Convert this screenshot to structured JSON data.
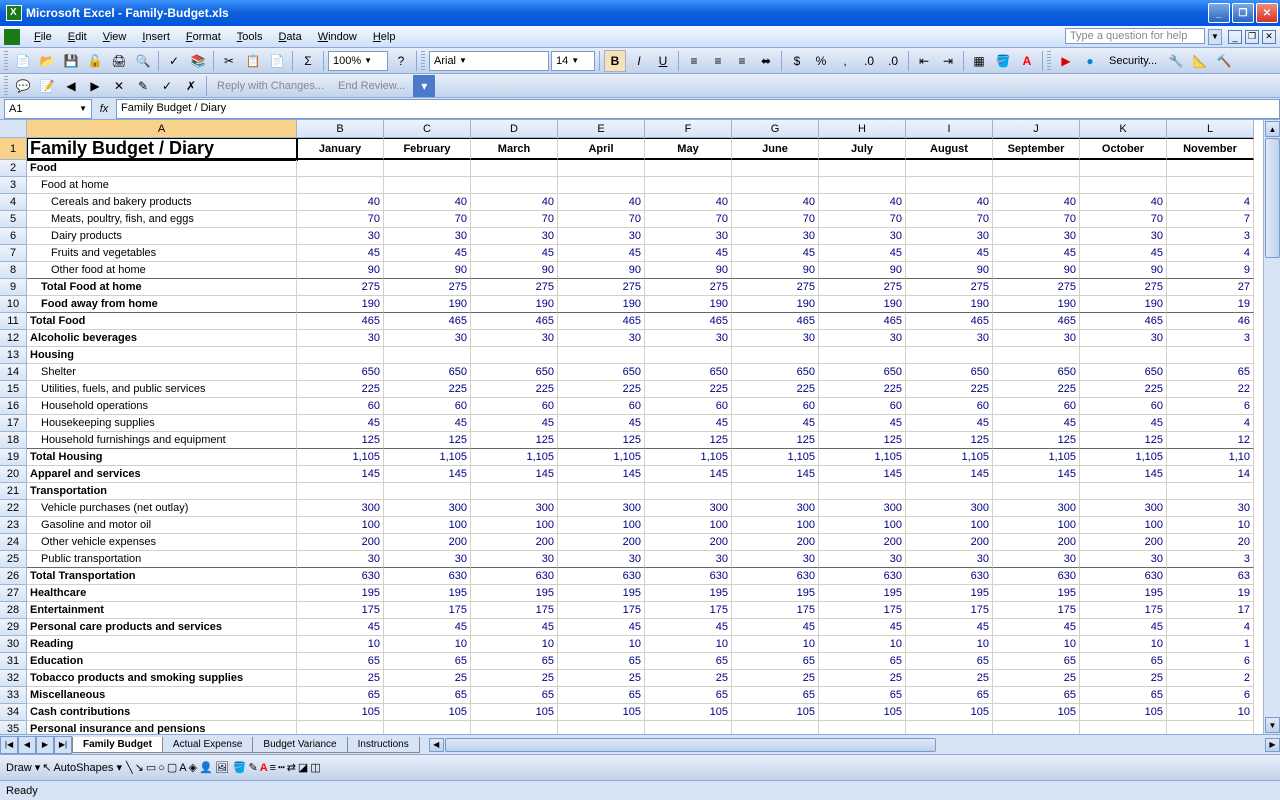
{
  "title": "Microsoft Excel - Family-Budget.xls",
  "menus": [
    "File",
    "Edit",
    "View",
    "Insert",
    "Format",
    "Tools",
    "Data",
    "Window",
    "Help"
  ],
  "helpPlaceholder": "Type a question for help",
  "zoom": "100%",
  "font": "Arial",
  "fontSize": "14",
  "review": {
    "reply": "Reply with Changes...",
    "end": "End Review..."
  },
  "nameBox": "A1",
  "formulaValue": "Family Budget / Diary",
  "security": "Security...",
  "colWidths": {
    "A": 270,
    "others": 87
  },
  "columns": [
    "A",
    "B",
    "C",
    "D",
    "E",
    "F",
    "G",
    "H",
    "I",
    "J",
    "K",
    "L"
  ],
  "months": [
    "January",
    "February",
    "March",
    "April",
    "May",
    "June",
    "July",
    "August",
    "September",
    "October",
    "November"
  ],
  "rows": [
    {
      "n": 1,
      "label": "Family Budget / Diary",
      "type": "title",
      "vals": "months"
    },
    {
      "n": 2,
      "label": "Food",
      "type": "section",
      "vals": []
    },
    {
      "n": 3,
      "label": "Food at home",
      "type": "indent1",
      "vals": []
    },
    {
      "n": 4,
      "label": "Cereals and bakery products",
      "type": "indent2",
      "vals": [
        "40",
        "40",
        "40",
        "40",
        "40",
        "40",
        "40",
        "40",
        "40",
        "40",
        "4"
      ]
    },
    {
      "n": 5,
      "label": "Meats, poultry, fish, and eggs",
      "type": "indent2",
      "vals": [
        "70",
        "70",
        "70",
        "70",
        "70",
        "70",
        "70",
        "70",
        "70",
        "70",
        "7"
      ]
    },
    {
      "n": 6,
      "label": "Dairy products",
      "type": "indent2",
      "vals": [
        "30",
        "30",
        "30",
        "30",
        "30",
        "30",
        "30",
        "30",
        "30",
        "30",
        "3"
      ]
    },
    {
      "n": 7,
      "label": "Fruits and vegetables",
      "type": "indent2",
      "vals": [
        "45",
        "45",
        "45",
        "45",
        "45",
        "45",
        "45",
        "45",
        "45",
        "45",
        "4"
      ]
    },
    {
      "n": 8,
      "label": "Other food at home",
      "type": "indent2",
      "vals": [
        "90",
        "90",
        "90",
        "90",
        "90",
        "90",
        "90",
        "90",
        "90",
        "90",
        "9"
      ],
      "bb": true
    },
    {
      "n": 9,
      "label": "Total Food at home",
      "type": "indent1 section",
      "vals": [
        "275",
        "275",
        "275",
        "275",
        "275",
        "275",
        "275",
        "275",
        "275",
        "275",
        "27"
      ]
    },
    {
      "n": 10,
      "label": "Food away from home",
      "type": "indent1 section",
      "vals": [
        "190",
        "190",
        "190",
        "190",
        "190",
        "190",
        "190",
        "190",
        "190",
        "190",
        "19"
      ],
      "bb": true
    },
    {
      "n": 11,
      "label": "Total Food",
      "type": "section",
      "vals": [
        "465",
        "465",
        "465",
        "465",
        "465",
        "465",
        "465",
        "465",
        "465",
        "465",
        "46"
      ]
    },
    {
      "n": 12,
      "label": "Alcoholic beverages",
      "type": "section",
      "vals": [
        "30",
        "30",
        "30",
        "30",
        "30",
        "30",
        "30",
        "30",
        "30",
        "30",
        "3"
      ]
    },
    {
      "n": 13,
      "label": "Housing",
      "type": "section",
      "vals": []
    },
    {
      "n": 14,
      "label": "Shelter",
      "type": "indent1",
      "vals": [
        "650",
        "650",
        "650",
        "650",
        "650",
        "650",
        "650",
        "650",
        "650",
        "650",
        "65"
      ]
    },
    {
      "n": 15,
      "label": "Utilities, fuels, and public services",
      "type": "indent1",
      "vals": [
        "225",
        "225",
        "225",
        "225",
        "225",
        "225",
        "225",
        "225",
        "225",
        "225",
        "22"
      ]
    },
    {
      "n": 16,
      "label": "Household operations",
      "type": "indent1",
      "vals": [
        "60",
        "60",
        "60",
        "60",
        "60",
        "60",
        "60",
        "60",
        "60",
        "60",
        "6"
      ]
    },
    {
      "n": 17,
      "label": "Housekeeping supplies",
      "type": "indent1",
      "vals": [
        "45",
        "45",
        "45",
        "45",
        "45",
        "45",
        "45",
        "45",
        "45",
        "45",
        "4"
      ]
    },
    {
      "n": 18,
      "label": "Household furnishings and equipment",
      "type": "indent1",
      "vals": [
        "125",
        "125",
        "125",
        "125",
        "125",
        "125",
        "125",
        "125",
        "125",
        "125",
        "12"
      ],
      "bb": true
    },
    {
      "n": 19,
      "label": "Total Housing",
      "type": "section",
      "vals": [
        "1,105",
        "1,105",
        "1,105",
        "1,105",
        "1,105",
        "1,105",
        "1,105",
        "1,105",
        "1,105",
        "1,105",
        "1,10"
      ]
    },
    {
      "n": 20,
      "label": "Apparel and services",
      "type": "section",
      "vals": [
        "145",
        "145",
        "145",
        "145",
        "145",
        "145",
        "145",
        "145",
        "145",
        "145",
        "14"
      ]
    },
    {
      "n": 21,
      "label": "Transportation",
      "type": "section",
      "vals": []
    },
    {
      "n": 22,
      "label": "Vehicle purchases (net outlay)",
      "type": "indent1",
      "vals": [
        "300",
        "300",
        "300",
        "300",
        "300",
        "300",
        "300",
        "300",
        "300",
        "300",
        "30"
      ]
    },
    {
      "n": 23,
      "label": "Gasoline and motor oil",
      "type": "indent1",
      "vals": [
        "100",
        "100",
        "100",
        "100",
        "100",
        "100",
        "100",
        "100",
        "100",
        "100",
        "10"
      ]
    },
    {
      "n": 24,
      "label": "Other vehicle expenses",
      "type": "indent1",
      "vals": [
        "200",
        "200",
        "200",
        "200",
        "200",
        "200",
        "200",
        "200",
        "200",
        "200",
        "20"
      ]
    },
    {
      "n": 25,
      "label": "Public transportation",
      "type": "indent1",
      "vals": [
        "30",
        "30",
        "30",
        "30",
        "30",
        "30",
        "30",
        "30",
        "30",
        "30",
        "3"
      ],
      "bb": true
    },
    {
      "n": 26,
      "label": "Total Transportation",
      "type": "section",
      "vals": [
        "630",
        "630",
        "630",
        "630",
        "630",
        "630",
        "630",
        "630",
        "630",
        "630",
        "63"
      ]
    },
    {
      "n": 27,
      "label": "Healthcare",
      "type": "section",
      "vals": [
        "195",
        "195",
        "195",
        "195",
        "195",
        "195",
        "195",
        "195",
        "195",
        "195",
        "19"
      ]
    },
    {
      "n": 28,
      "label": "Entertainment",
      "type": "section",
      "vals": [
        "175",
        "175",
        "175",
        "175",
        "175",
        "175",
        "175",
        "175",
        "175",
        "175",
        "17"
      ]
    },
    {
      "n": 29,
      "label": "Personal care products and services",
      "type": "section",
      "vals": [
        "45",
        "45",
        "45",
        "45",
        "45",
        "45",
        "45",
        "45",
        "45",
        "45",
        "4"
      ]
    },
    {
      "n": 30,
      "label": "Reading",
      "type": "section",
      "vals": [
        "10",
        "10",
        "10",
        "10",
        "10",
        "10",
        "10",
        "10",
        "10",
        "10",
        "1"
      ]
    },
    {
      "n": 31,
      "label": "Education",
      "type": "section",
      "vals": [
        "65",
        "65",
        "65",
        "65",
        "65",
        "65",
        "65",
        "65",
        "65",
        "65",
        "6"
      ]
    },
    {
      "n": 32,
      "label": "Tobacco products and smoking supplies",
      "type": "section",
      "vals": [
        "25",
        "25",
        "25",
        "25",
        "25",
        "25",
        "25",
        "25",
        "25",
        "25",
        "2"
      ]
    },
    {
      "n": 33,
      "label": "Miscellaneous",
      "type": "section",
      "vals": [
        "65",
        "65",
        "65",
        "65",
        "65",
        "65",
        "65",
        "65",
        "65",
        "65",
        "6"
      ]
    },
    {
      "n": 34,
      "label": "Cash contributions",
      "type": "section",
      "vals": [
        "105",
        "105",
        "105",
        "105",
        "105",
        "105",
        "105",
        "105",
        "105",
        "105",
        "10"
      ]
    },
    {
      "n": 35,
      "label": "Personal insurance and pensions",
      "type": "section",
      "vals": []
    }
  ],
  "sheetTabs": [
    "Family Budget",
    "Actual Expense",
    "Budget Variance",
    "Instructions"
  ],
  "activeTab": 0,
  "draw": "Draw",
  "autoshapes": "AutoShapes",
  "status": "Ready"
}
